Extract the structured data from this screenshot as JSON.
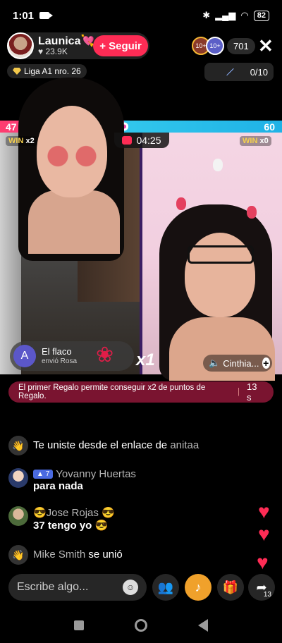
{
  "status_bar": {
    "time": "1:01",
    "battery": "82"
  },
  "host": {
    "name": "Launica💘",
    "likes": "♥ 23.9K",
    "follow_label": "+ Seguir"
  },
  "viewers": {
    "count": "701",
    "badge1": "10+",
    "badge2": "10+"
  },
  "league": {
    "label": "Liga A1 nro. 26"
  },
  "gift_progress": {
    "value": "0/10"
  },
  "battle": {
    "left_score": "47",
    "right_score": "60",
    "timer": "04:25",
    "left_win": "x2",
    "right_win": "x0",
    "win_word": "WIN",
    "colors": {
      "left": "#ff3d6f",
      "right": "#32c7ec"
    }
  },
  "gift_card": {
    "avatar_letter": "A",
    "name": "El flaco",
    "sub": "envió Rosa",
    "multiplier": "x1"
  },
  "opponent": {
    "name": "Cinthia..."
  },
  "notice": {
    "text": "El primer Regalo permite conseguir x2 de puntos de Regalo.",
    "seconds": "13 s"
  },
  "chat": [
    {
      "user": "",
      "text": "Te uniste desde el enlace de",
      "highlight": "anitaa"
    },
    {
      "level": "7",
      "user": "Yovanny Huertas",
      "text": "para nada"
    },
    {
      "user": "😎Jose Rojas 😎",
      "text": "37 tengo yo 😎"
    },
    {
      "user": "Mike Smith",
      "text": "se unió"
    }
  ],
  "input": {
    "placeholder": "Escribe algo..."
  },
  "share": {
    "count": "13"
  },
  "icons": [
    "video-camera-icon",
    "bluetooth-icon",
    "signal-icon",
    "wifi-icon",
    "battery-icon",
    "close-icon",
    "diamond-icon",
    "gem-icon",
    "emoji-icon",
    "multi-guest-icon",
    "gift-icon",
    "share-icon",
    "heart-icon",
    "wave-icon"
  ]
}
